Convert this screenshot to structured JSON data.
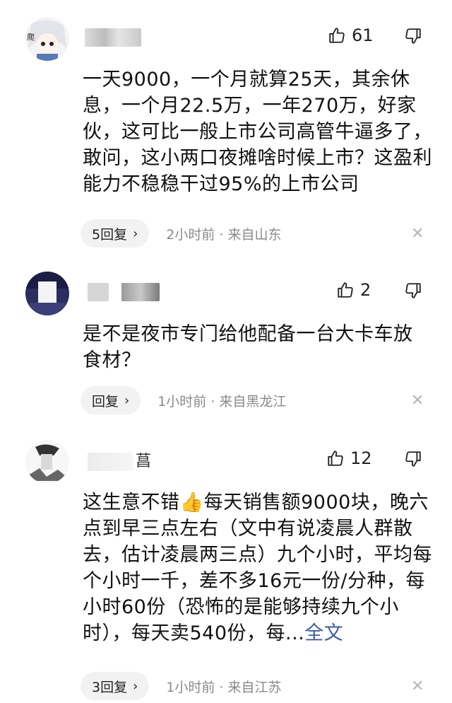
{
  "comments": [
    {
      "name_fragment": "",
      "avatar_label": "爬",
      "likes": "61",
      "text": "一天9000，一个月就算25天，其余休息，一个月22.5万，一年270万，好家伙，这可比一般上市公司高管牛逼多了，敢问，这小两口夜摊啥时候上市？这盈利能力不稳稳干过95%的上市公司",
      "more": "",
      "reply_label": "5回复",
      "time_location": "2小时前 · 来自山东"
    },
    {
      "name_fragment": "",
      "avatar_label": "",
      "likes": "2",
      "text": "是不是夜市专门给他配备一台大卡车放食材？",
      "more": "",
      "reply_label": "回复",
      "time_location": "1小时前 · 来自黑龙江"
    },
    {
      "name_fragment": "菖",
      "avatar_label": "",
      "likes": "12",
      "text": "这生意不错👍每天销售额9000块，晚六点到早三点左右（文中有说凌晨人群散去，估计凌晨两三点）九个小时，平均每个小时一千，差不多16元一份/分种，每小时60份（恐怖的是能够持续九个小时），每天卖540份，每...",
      "more": "全文",
      "reply_label": "3回复",
      "time_location": "1小时前 · 来自江苏"
    }
  ]
}
